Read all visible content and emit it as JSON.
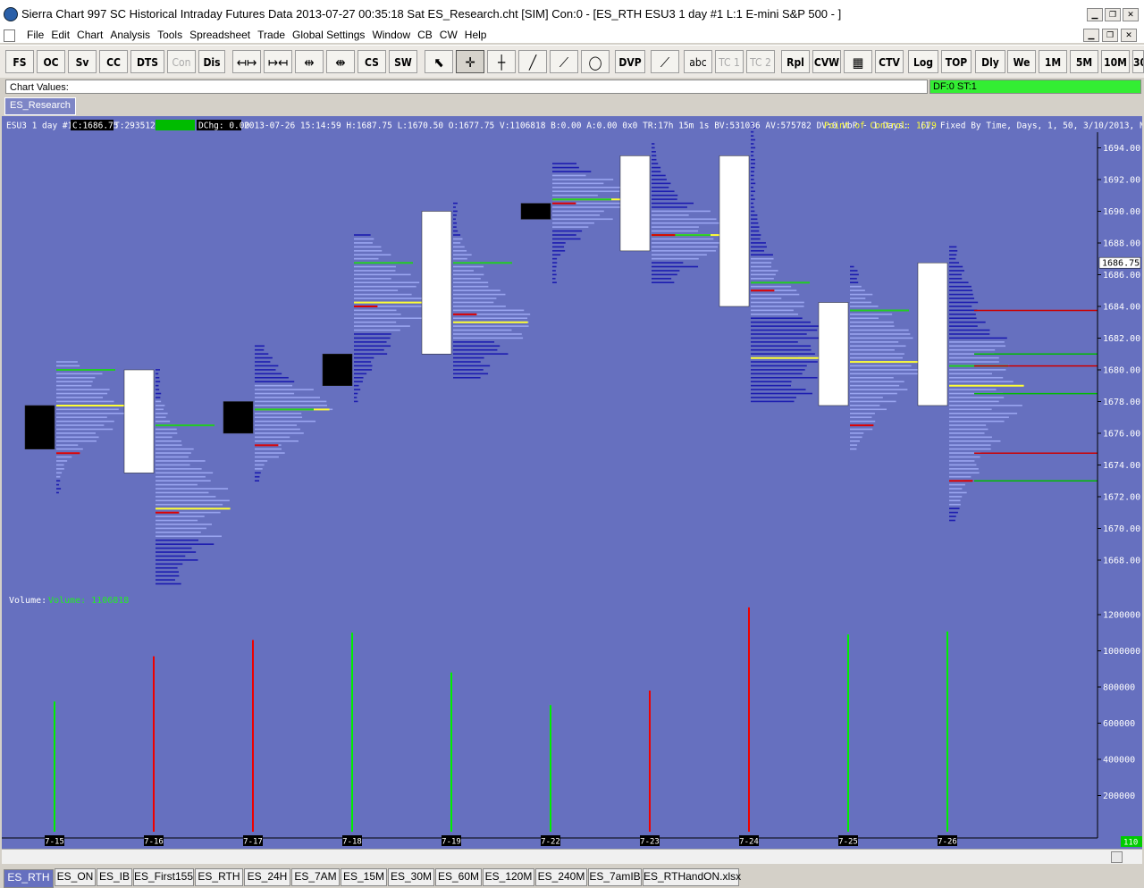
{
  "window": {
    "title": "Sierra Chart 997 SC Historical Intraday Futures Data 2013-07-27  00:35:18 Sat  ES_Research.cht [SIM] Con:0 - [ES_RTH  ESU3  1 day   #1  L:1  E-mini S&P 500 - ]"
  },
  "menu": [
    "File",
    "Edit",
    "Chart",
    "Analysis",
    "Tools",
    "Spreadsheet",
    "Trade",
    "Global Settings",
    "Window",
    "CB",
    "CW",
    "Help"
  ],
  "toolbar": {
    "buttons": [
      "FS",
      "OC",
      "Sv",
      "CC",
      "DTS",
      "Con",
      "Dis",
      "DVP",
      "abc",
      "TC 1",
      "TC 2",
      "Rpl",
      "CVW",
      "CTV",
      "Log",
      "TOP",
      "Dly",
      "We",
      "1M",
      "5M",
      "10M",
      "30"
    ]
  },
  "chart_values_label": "Chart Values:",
  "status_box": "DF:0  ST:1",
  "chart_tab": "ES_Research",
  "chart": {
    "header": {
      "symbol": "ESU3  1 day  #1",
      "last": "C:1686.75",
      "trades": "T:293512",
      "change": "DChg: 0.00",
      "bar_info": "2013-07-26 15:14:59 H:1687.75 L:1670.50 O:1677.75 V:1106818 B:0.00 A:0.00 0x0 TR:17h 15m 1s BV:531036 AV:575782 DV:0 VbP - 1 Days:",
      "poc_label": "Point of Control: 1679",
      "study_params": "(1, Fixed By Time, Days, 1, 50, 3/10/2013, N"
    },
    "price_label": "1686.75",
    "volume_label": "Volume:",
    "volume_value": "Volume: 1106818",
    "right_corner_value": "110",
    "colors": {
      "background": "#6670bf",
      "up": "#ffffff",
      "down": "#000000",
      "profile_light": "#9aa5f0",
      "profile_dark": "#1c1cb0",
      "poc": "#ffff33",
      "vah": "#22cc22",
      "val": "#dd0000",
      "vol_up": "#00ee00",
      "vol_down": "#ee0000"
    }
  },
  "chart_data": {
    "type": "candlestick_with_volume_profile",
    "title": "ESU3 1 day",
    "price_axis": {
      "ylim": [
        1666,
        1695.4
      ],
      "ticks": [
        1694,
        1692,
        1690,
        1688,
        1686,
        1684,
        1682,
        1680,
        1678,
        1676,
        1674,
        1672,
        1670,
        1668
      ]
    },
    "volume_axis": {
      "ylim": [
        0,
        1270000
      ],
      "ticks": [
        1200000,
        1000000,
        800000,
        600000,
        400000,
        200000
      ]
    },
    "dates": [
      "7-15",
      "7-16",
      "7-17",
      "7-18",
      "7-19",
      "7-22",
      "7-23",
      "7-24",
      "7-25",
      "7-26"
    ],
    "candles": [
      {
        "date": "7-15",
        "open": 1677.75,
        "close": 1675,
        "high": 1680.5,
        "low": 1672.25
      },
      {
        "date": "7-16",
        "open": 1673.5,
        "close": 1680,
        "high": 1680,
        "low": 1666.5
      },
      {
        "date": "7-17",
        "open": 1678,
        "close": 1676,
        "high": 1681.5,
        "low": 1673
      },
      {
        "date": "7-18",
        "open": 1681,
        "close": 1679,
        "high": 1688.5,
        "low": 1678
      },
      {
        "date": "7-19",
        "open": 1681,
        "close": 1690,
        "high": 1690.5,
        "low": 1679.5
      },
      {
        "date": "7-22",
        "open": 1690.5,
        "close": 1689.5,
        "high": 1693,
        "low": 1685.5
      },
      {
        "date": "7-23",
        "open": 1687.5,
        "close": 1693.5,
        "high": 1694.2,
        "low": 1685.5
      },
      {
        "date": "7-24",
        "open": 1684,
        "close": 1693.5,
        "high": 1695.4,
        "low": 1678
      },
      {
        "date": "7-25",
        "open": 1677.75,
        "close": 1684.25,
        "high": 1686.5,
        "low": 1675
      },
      {
        "date": "7-26",
        "open": 1677.75,
        "close": 1686.75,
        "high": 1687.75,
        "low": 1670.5
      }
    ],
    "volume": [
      {
        "date": "7-15",
        "value": 720000,
        "color": "green"
      },
      {
        "date": "7-16",
        "value": 970000,
        "color": "red"
      },
      {
        "date": "7-17",
        "value": 1060000,
        "color": "red"
      },
      {
        "date": "7-18",
        "value": 1100000,
        "color": "green"
      },
      {
        "date": "7-19",
        "value": 880000,
        "color": "green"
      },
      {
        "date": "7-22",
        "value": 700000,
        "color": "green"
      },
      {
        "date": "7-23",
        "value": 780000,
        "color": "red"
      },
      {
        "date": "7-24",
        "value": 1240000,
        "color": "red"
      },
      {
        "date": "7-25",
        "value": 1090000,
        "color": "green"
      },
      {
        "date": "7-26",
        "value": 1106818,
        "color": "green"
      }
    ],
    "value_areas": [
      {
        "date": "7-15",
        "poc": 1677.75,
        "vah": 1680,
        "val": 1674.75
      },
      {
        "date": "7-16",
        "poc": 1671.25,
        "vah": 1676.5,
        "val": 1671
      },
      {
        "date": "7-17",
        "poc": 1677.5,
        "vah": 1677.5,
        "val": 1675.25
      },
      {
        "date": "7-18",
        "poc": 1684.25,
        "vah": 1686.75,
        "val": 1684
      },
      {
        "date": "7-19",
        "poc": 1683,
        "vah": 1686.75,
        "val": 1683.5
      },
      {
        "date": "7-22",
        "poc": 1690.75,
        "vah": 1690.75,
        "val": 1690.5
      },
      {
        "date": "7-23",
        "poc": 1688.5,
        "vah": 1688.5,
        "val": 1688.5
      },
      {
        "date": "7-24",
        "poc": 1680.75,
        "vah": 1685.5,
        "val": 1685
      },
      {
        "date": "7-25",
        "poc": 1680.5,
        "vah": 1683.75,
        "val": 1676.5
      },
      {
        "date": "7-26",
        "poc": 1679,
        "vah": 1680.25,
        "val": 1673
      }
    ],
    "naked_levels": [
      {
        "price": 1683.75,
        "color": "red",
        "from": "7-26"
      },
      {
        "price": 1681,
        "color": "green",
        "from": "7-26"
      },
      {
        "price": 1680.25,
        "color": "red",
        "from": "7-26"
      },
      {
        "price": 1678.5,
        "color": "green",
        "from": "7-26"
      },
      {
        "price": 1674.75,
        "color": "red",
        "from": "7-26"
      },
      {
        "price": 1673,
        "color": "green",
        "from": "7-26"
      }
    ]
  },
  "bottom_tabs": [
    "ES_RTH",
    "ES_ON",
    "ES_IB",
    "ES_First155",
    "ES_RTH",
    "ES_24H",
    "ES_7AM",
    "ES_15M",
    "ES_30M",
    "ES_60M",
    "ES_120M",
    "ES_240M",
    "ES_7amIB",
    "ES_RTHandON.xlsx"
  ]
}
